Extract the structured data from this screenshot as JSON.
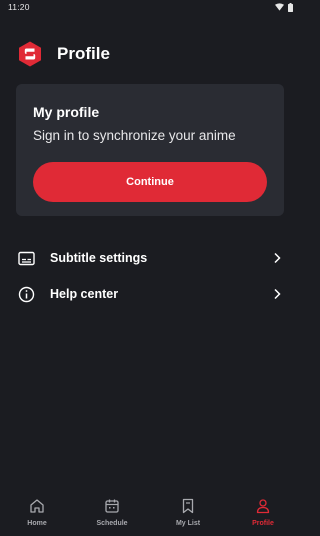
{
  "status": {
    "time": "11:20"
  },
  "header": {
    "title": "Profile",
    "logo_icon": "app-logo-icon"
  },
  "card": {
    "title": "My profile",
    "subtitle": "Sign in to synchronize your anime",
    "button_label": "Continue"
  },
  "menu": [
    {
      "label": "Subtitle settings",
      "icon": "subtitles-icon"
    },
    {
      "label": "Help center",
      "icon": "info-icon"
    }
  ],
  "nav": [
    {
      "label": "Home",
      "icon": "home-icon"
    },
    {
      "label": "Schedule",
      "icon": "calendar-icon"
    },
    {
      "label": "My List",
      "icon": "bookmark-icon"
    },
    {
      "label": "Profile",
      "icon": "person-icon",
      "active": true
    }
  ],
  "colors": {
    "accent": "#e02a36",
    "background": "#1b1c21",
    "card": "#2a2c33"
  }
}
